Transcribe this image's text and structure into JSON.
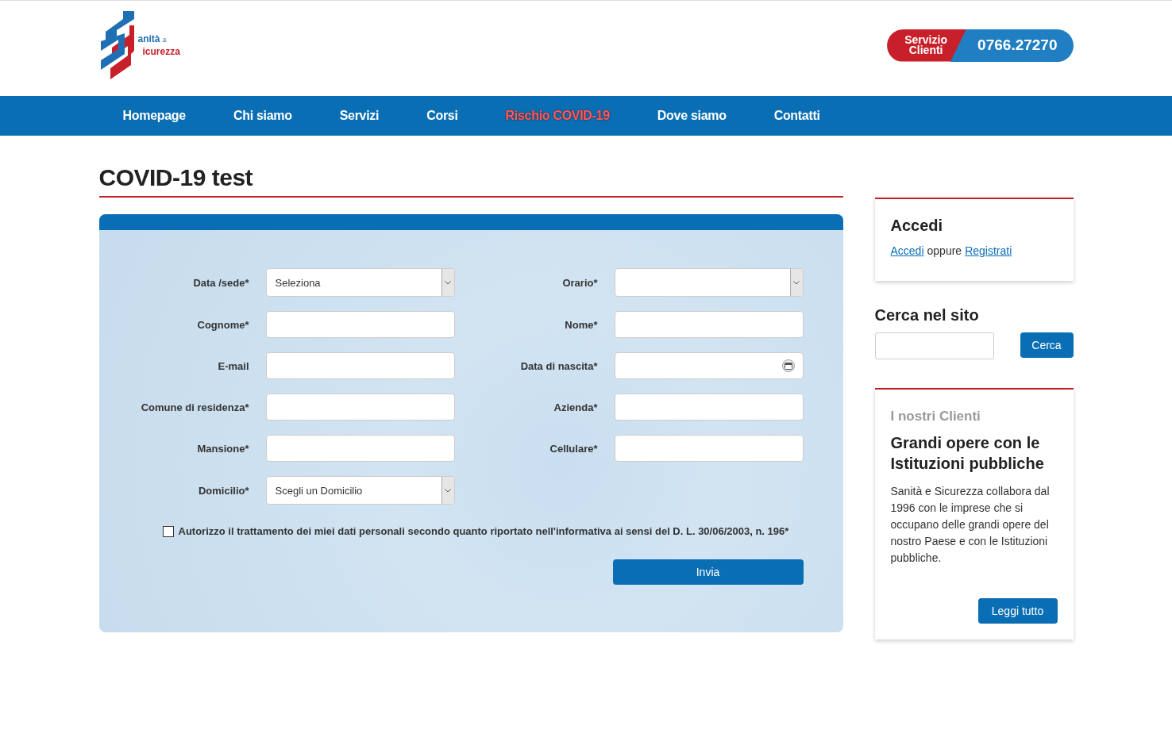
{
  "logo": {
    "line1": "anità",
    "amp": "&",
    "line2": "icurezza"
  },
  "phone": {
    "label": "Servizio Clienti",
    "number": "0766.27270"
  },
  "nav": [
    {
      "label": "Homepage",
      "selected": false
    },
    {
      "label": "Chi siamo",
      "selected": false
    },
    {
      "label": "Servizi",
      "selected": false
    },
    {
      "label": "Corsi",
      "selected": false
    },
    {
      "label": "Rischio COVID-19",
      "selected": true
    },
    {
      "label": "Dove siamo",
      "selected": false
    },
    {
      "label": "Contatti",
      "selected": false
    }
  ],
  "page_title": "COVID-19 test",
  "form": {
    "rows": [
      {
        "left": {
          "label": "Data /sede*",
          "kind": "select",
          "value": "Seleziona"
        },
        "right": {
          "label": "Orario*",
          "kind": "select"
        }
      },
      {
        "left": {
          "label": "Cognome*",
          "kind": "text"
        },
        "right": {
          "label": "Nome*",
          "kind": "text"
        }
      },
      {
        "left": {
          "label": "E-mail",
          "kind": "text"
        },
        "right": {
          "label": "Data di nascita*",
          "kind": "date"
        }
      },
      {
        "left": {
          "label": "Comune di residenza*",
          "kind": "text"
        },
        "right": {
          "label": "Azienda*",
          "kind": "text"
        }
      },
      {
        "left": {
          "label": "Mansione*",
          "kind": "text"
        },
        "right": {
          "label": "Cellulare*",
          "kind": "text"
        }
      },
      {
        "left": {
          "label": "Domicilio*",
          "kind": "select",
          "value": "Scegli un Domicilio"
        }
      }
    ],
    "consent": {
      "label": "Autorizzo il trattamento dei miei dati personali secondo quanto riportato nell'informativa ai sensi del D. L. 30/06/2003, n. 196*",
      "checked": false
    },
    "submit": "Invia"
  },
  "login_card": {
    "title": "Accedi",
    "link1": "Accedi",
    "between": "oppure",
    "link2": "Registrati"
  },
  "search": {
    "title": "Cerca nel sito",
    "button": "Cerca"
  },
  "clients_card": {
    "kicker": "I nostri Clienti",
    "title": "Grandi opere con le Istituzioni pubbliche",
    "text": "Sanità e Sicurezza collabora dal 1996 con le imprese che si occupano delle grandi opere del nostro Paese e con le Istituzioni pubbliche.",
    "button": "Leggi tutto"
  }
}
